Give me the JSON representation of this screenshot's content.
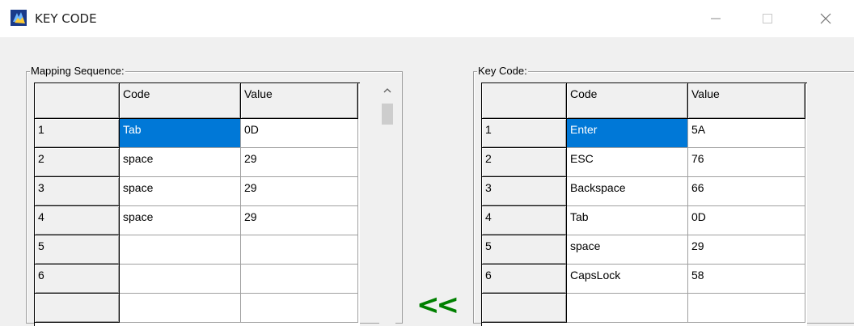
{
  "window": {
    "title": "KEY CODE",
    "icons": {
      "app": "app-icon",
      "minimize": "minimize-icon",
      "maximize": "maximize-icon",
      "close": "close-icon"
    }
  },
  "mapping": {
    "label": "Mapping Sequence:",
    "headers": [
      "Code",
      "Value"
    ],
    "rows": [
      {
        "n": "1",
        "code": "Tab",
        "value": "0D"
      },
      {
        "n": "2",
        "code": "space",
        "value": "29"
      },
      {
        "n": "3",
        "code": "space",
        "value": "29"
      },
      {
        "n": "4",
        "code": "space",
        "value": "29"
      },
      {
        "n": "5",
        "code": "",
        "value": ""
      },
      {
        "n": "6",
        "code": "",
        "value": ""
      },
      {
        "n": "",
        "code": "",
        "value": ""
      }
    ]
  },
  "keycode": {
    "label": "Key Code:",
    "headers": [
      "Code",
      "Value"
    ],
    "rows": [
      {
        "n": "1",
        "code": "Enter",
        "value": "5A"
      },
      {
        "n": "2",
        "code": "ESC",
        "value": "76"
      },
      {
        "n": "3",
        "code": "Backspace",
        "value": "66"
      },
      {
        "n": "4",
        "code": "Tab",
        "value": "0D"
      },
      {
        "n": "5",
        "code": "space",
        "value": "29"
      },
      {
        "n": "6",
        "code": "CapsLock",
        "value": "58"
      },
      {
        "n": "",
        "code": "",
        "value": ""
      }
    ]
  },
  "transfer_button": {
    "label": "<<",
    "color": "#008000"
  },
  "selection_color": "#0078d7"
}
